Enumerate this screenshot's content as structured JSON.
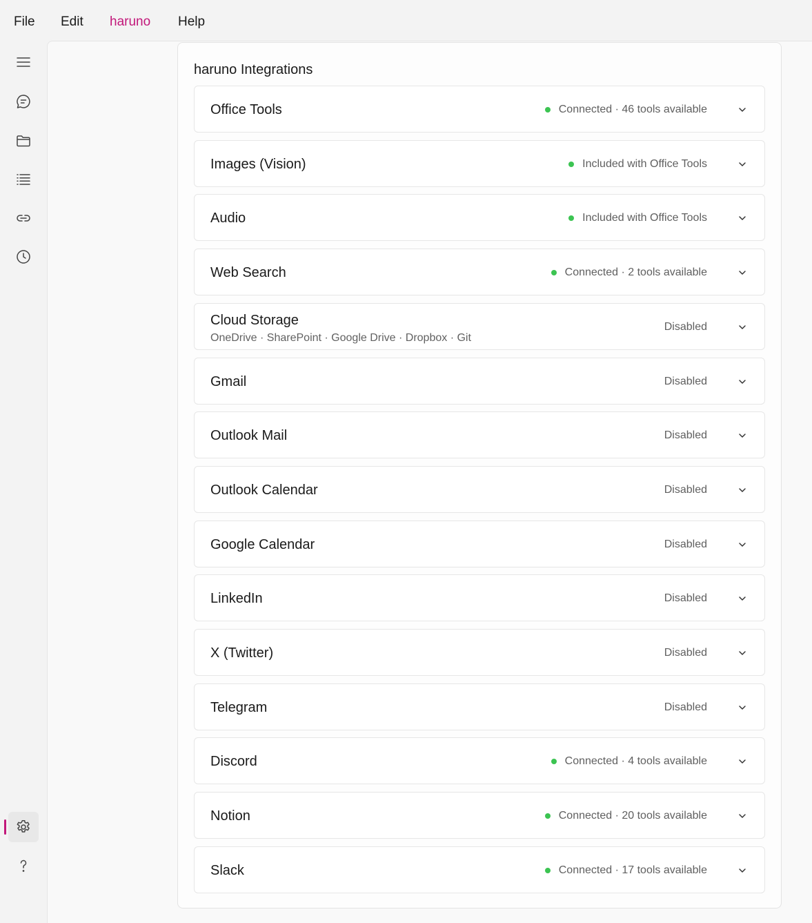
{
  "menubar": {
    "items": [
      "File",
      "Edit",
      "haruno",
      "Help"
    ],
    "active_color": "#c2187a"
  },
  "sidebar": {
    "icons": [
      "menu-icon",
      "chat-icon",
      "folder-icon",
      "list-icon",
      "link-icon",
      "history-icon",
      "settings-icon",
      "help-icon"
    ],
    "active": "settings-icon"
  },
  "panel": {
    "title": "haruno Integrations",
    "integrations": [
      {
        "name": "Office Tools",
        "status": "Connected · 46 tools available",
        "connected": true
      },
      {
        "name": "Images (Vision)",
        "status": "Included with Office Tools",
        "connected": true
      },
      {
        "name": "Audio",
        "status": "Included with Office Tools",
        "connected": true
      },
      {
        "name": "Web Search",
        "status": "Connected · 2 tools available",
        "connected": true
      },
      {
        "name": "Cloud Storage",
        "subtitle": "OneDrive · SharePoint · Google Drive · Dropbox · Git",
        "status": "Disabled",
        "connected": false
      },
      {
        "name": "Gmail",
        "status": "Disabled",
        "connected": false
      },
      {
        "name": "Outlook Mail",
        "status": "Disabled",
        "connected": false
      },
      {
        "name": "Outlook Calendar",
        "status": "Disabled",
        "connected": false
      },
      {
        "name": "Google Calendar",
        "status": "Disabled",
        "connected": false
      },
      {
        "name": "LinkedIn",
        "status": "Disabled",
        "connected": false
      },
      {
        "name": "X (Twitter)",
        "status": "Disabled",
        "connected": false
      },
      {
        "name": "Telegram",
        "status": "Disabled",
        "connected": false
      },
      {
        "name": "Discord",
        "status": "Connected · 4 tools available",
        "connected": true
      },
      {
        "name": "Notion",
        "status": "Connected · 20 tools available",
        "connected": true
      },
      {
        "name": "Slack",
        "status": "Connected · 17 tools available",
        "connected": true
      }
    ],
    "status_dot_color": "#3cc452"
  }
}
